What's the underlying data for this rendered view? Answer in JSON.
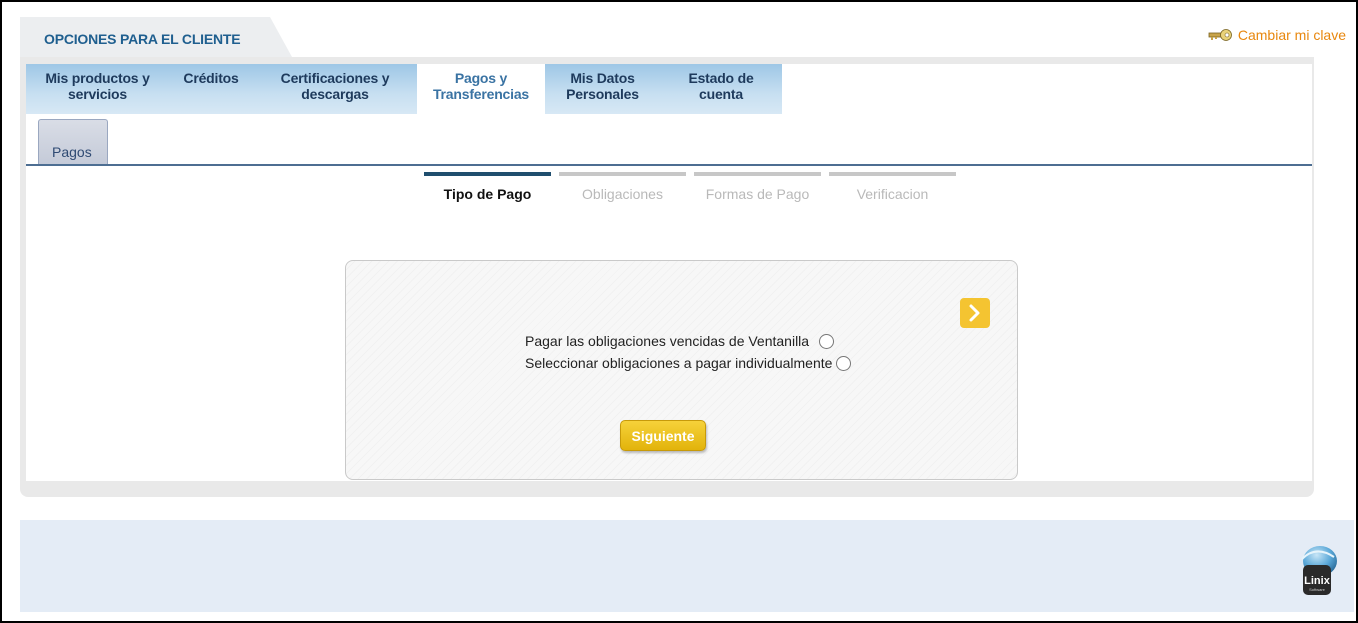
{
  "header": {
    "title": "OPCIONES PARA EL CLIENTE",
    "change_password": "Cambiar mi clave"
  },
  "main_tabs": [
    {
      "label_line1": "Mis productos y",
      "label_line2": "servicios"
    },
    {
      "label_line1": "Créditos",
      "label_line2": ""
    },
    {
      "label_line1": "Certificaciones y",
      "label_line2": "descargas"
    },
    {
      "label_line1": "Pagos y",
      "label_line2": "Transferencias",
      "active": true
    },
    {
      "label_line1": "Mis Datos",
      "label_line2": "Personales"
    },
    {
      "label_line1": "Estado de",
      "label_line2": "cuenta"
    }
  ],
  "sub_tabs": [
    {
      "label": "Pagos"
    }
  ],
  "steps": [
    {
      "label": "Tipo de Pago",
      "active": true
    },
    {
      "label": "Obligaciones"
    },
    {
      "label": "Formas de Pago"
    },
    {
      "label": "Verificacion"
    }
  ],
  "form": {
    "option_1": "Pagar las obligaciones vencidas de Ventanilla",
    "option_2": "Seleccionar obligaciones a pagar individualmente",
    "next_button": "Siguiente"
  },
  "footer": {
    "logo_text": "Linix",
    "logo_subtext": "Software"
  },
  "colors": {
    "accent_orange": "#e8870e",
    "button_yellow": "#f4c431",
    "active_step": "#1f4e6e"
  },
  "icons": [
    "key-icon",
    "arrow-right-icon",
    "linix-logo"
  ]
}
